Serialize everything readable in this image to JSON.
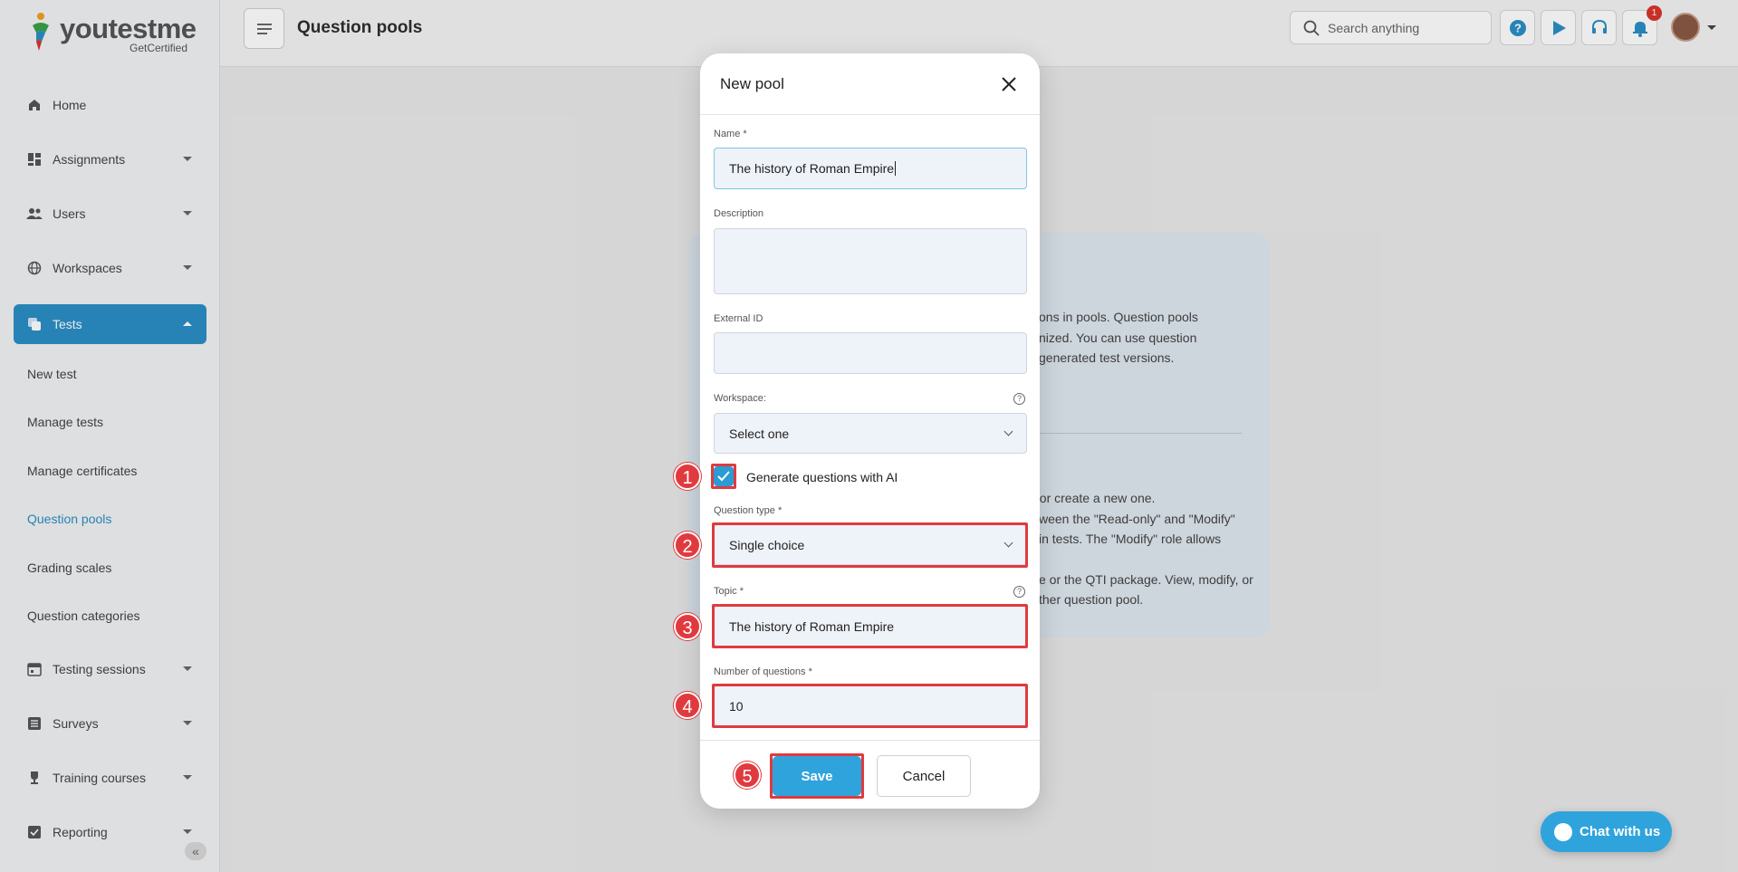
{
  "app": {
    "logo_text": "youtestme",
    "logo_sub": "GetCertified",
    "page_title": "Question pools"
  },
  "sidebar": {
    "items": [
      {
        "label": "Home",
        "icon": "home-icon"
      },
      {
        "label": "Assignments",
        "icon": "dashboard-icon"
      },
      {
        "label": "Users",
        "icon": "users-icon"
      },
      {
        "label": "Workspaces",
        "icon": "globe-icon"
      },
      {
        "label": "Tests",
        "icon": "tests-icon"
      },
      {
        "label": "Testing sessions",
        "icon": "calendar-icon"
      },
      {
        "label": "Surveys",
        "icon": "list-icon"
      },
      {
        "label": "Training courses",
        "icon": "trophy-icon"
      },
      {
        "label": "Reporting",
        "icon": "report-icon"
      }
    ],
    "tests_submenu": [
      "New test",
      "Manage tests",
      "Manage certificates",
      "Question pools",
      "Grading scales",
      "Question categories"
    ],
    "collapse_glyph": "«"
  },
  "topbar": {
    "search_placeholder": "Search anything",
    "notification_count": "1"
  },
  "background_info": {
    "lines": [
      "ons in pools. Question pools",
      "nized. You can use question",
      "generated test versions.",
      "t or create a new one.",
      "ween the \"Read-only\" and \"Modify\"",
      "in tests. The \"Modify\" role allows",
      "e or the QTI package. View, modify, or",
      "ther question pool."
    ]
  },
  "modal": {
    "title": "New pool",
    "name_label": "Name",
    "name_value": "The history of Roman Empire",
    "description_label": "Description",
    "external_id_label": "External ID",
    "workspace_label": "Workspace:",
    "workspace_value": "Select one",
    "generate_ai_label": "Generate questions with AI",
    "generate_ai_checked": true,
    "question_type_label": "Question type",
    "question_type_value": "Single choice",
    "topic_label": "Topic",
    "topic_value": "The history of Roman Empire",
    "num_questions_label": "Number of questions",
    "num_questions_value": "10",
    "required_mark": "*",
    "save_label": "Save",
    "cancel_label": "Cancel"
  },
  "annotations": [
    "1",
    "2",
    "3",
    "4",
    "5"
  ],
  "chat": {
    "label": "Chat with us"
  },
  "colors": {
    "accent": "#2b8fc6",
    "button": "#2fa3dc",
    "highlight": "#e03a3f",
    "badge": "#d9342b"
  }
}
